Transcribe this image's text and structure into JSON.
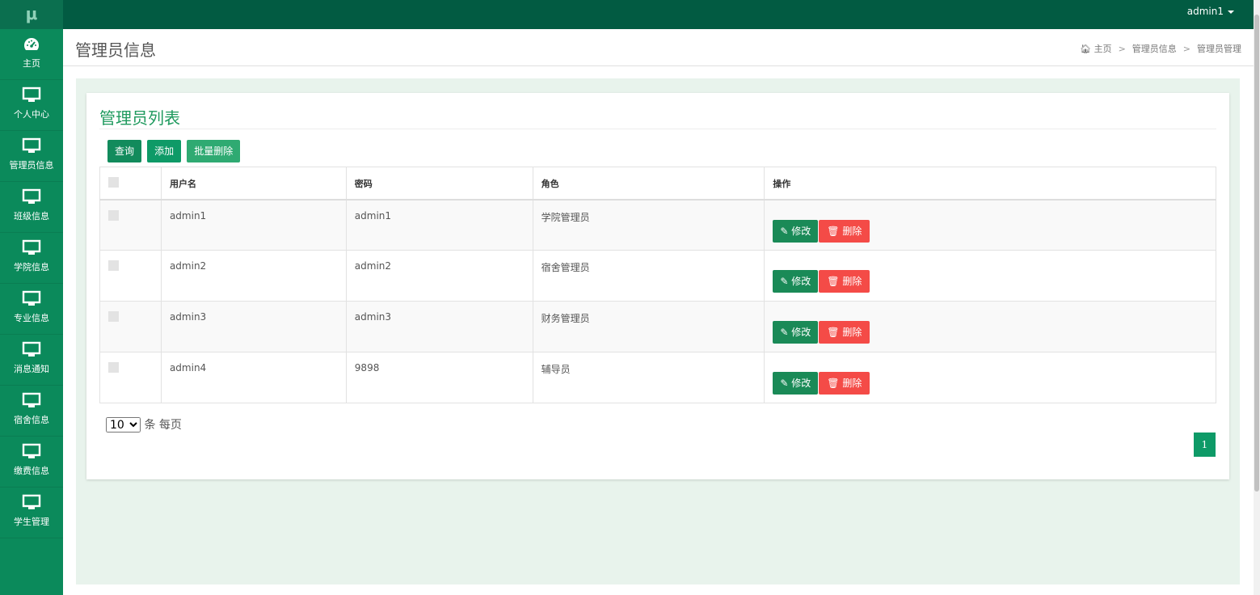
{
  "app": {
    "logo": "μ",
    "user": "admin1"
  },
  "sidebar": {
    "items": [
      {
        "label": "主页",
        "icon": "dashboard-icon"
      },
      {
        "label": "个人中心",
        "icon": "monitor-icon"
      },
      {
        "label": "管理员信息",
        "icon": "monitor-icon"
      },
      {
        "label": "班级信息",
        "icon": "monitor-icon"
      },
      {
        "label": "学院信息",
        "icon": "monitor-icon"
      },
      {
        "label": "专业信息",
        "icon": "monitor-icon"
      },
      {
        "label": "消息通知",
        "icon": "monitor-icon"
      },
      {
        "label": "宿舍信息",
        "icon": "monitor-icon"
      },
      {
        "label": "缴费信息",
        "icon": "monitor-icon"
      },
      {
        "label": "学生管理",
        "icon": "monitor-icon"
      }
    ]
  },
  "header": {
    "title": "管理员信息",
    "breadcrumb": [
      "主页",
      "管理员信息",
      "管理员管理"
    ]
  },
  "panel": {
    "title": "管理员列表",
    "buttons": {
      "query": "查询",
      "add": "添加",
      "batch_delete": "批量删除"
    },
    "columns": [
      "用户名",
      "密码",
      "角色",
      "操作"
    ],
    "rows": [
      {
        "username": "admin1",
        "password": "admin1",
        "role": "学院管理员"
      },
      {
        "username": "admin2",
        "password": "admin2",
        "role": "宿舍管理员"
      },
      {
        "username": "admin3",
        "password": "admin3",
        "role": "财务管理员"
      },
      {
        "username": "admin4",
        "password": "9898",
        "role": "辅导员"
      }
    ],
    "row_actions": {
      "edit": "修改",
      "delete": "删除"
    },
    "page_size": {
      "value": "10",
      "suffix": "条 每页"
    },
    "current_page": "1"
  },
  "colors": {
    "topbar": "#025b42",
    "sidebar": "#0b8a5b",
    "accent": "#0e9a67",
    "danger": "#f44b47"
  }
}
